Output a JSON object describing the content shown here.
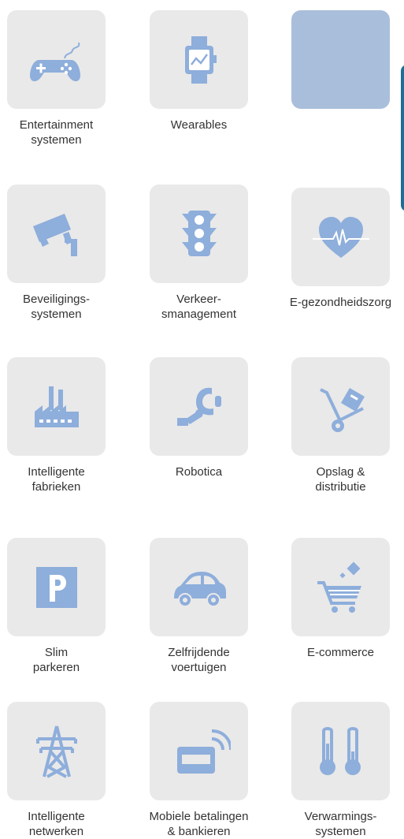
{
  "colors": {
    "tile_bg": "#e9e9e9",
    "tile_active_bg": "#a9bedb",
    "icon": "#8eaedb",
    "edge_bar": "#1f6e95"
  },
  "tiles": [
    {
      "label": "Entertainment\nsystemen",
      "icon": "gamepad-icon"
    },
    {
      "label": "Wearables",
      "icon": "smartwatch-icon"
    },
    {
      "label": "",
      "icon": "",
      "selected": true
    },
    {
      "label": "Beveiligings-\nsystemen",
      "icon": "security-camera-icon"
    },
    {
      "label": "Verkeer-\nsmanagement",
      "icon": "traffic-light-icon"
    },
    {
      "label": "E-gezondheidszorg",
      "icon": "heart-pulse-icon"
    },
    {
      "label": "Intelligente\nfabrieken",
      "icon": "factory-icon"
    },
    {
      "label": "Robotica",
      "icon": "robot-arm-icon"
    },
    {
      "label": "Opslag &\ndistributie",
      "icon": "hand-truck-icon"
    },
    {
      "label": "Slim\nparkeren",
      "icon": "parking-icon"
    },
    {
      "label": "Zelfrijdende\nvoertuigen",
      "icon": "car-icon"
    },
    {
      "label": "E-commerce",
      "icon": "shopping-cart-icon"
    },
    {
      "label": "Intelligente\nnetwerken",
      "icon": "power-tower-icon"
    },
    {
      "label": "Mobiele betalingen\n& bankieren",
      "icon": "mobile-wifi-icon"
    },
    {
      "label": "Verwarmings-\nsystemen",
      "icon": "thermometer-icon"
    }
  ]
}
